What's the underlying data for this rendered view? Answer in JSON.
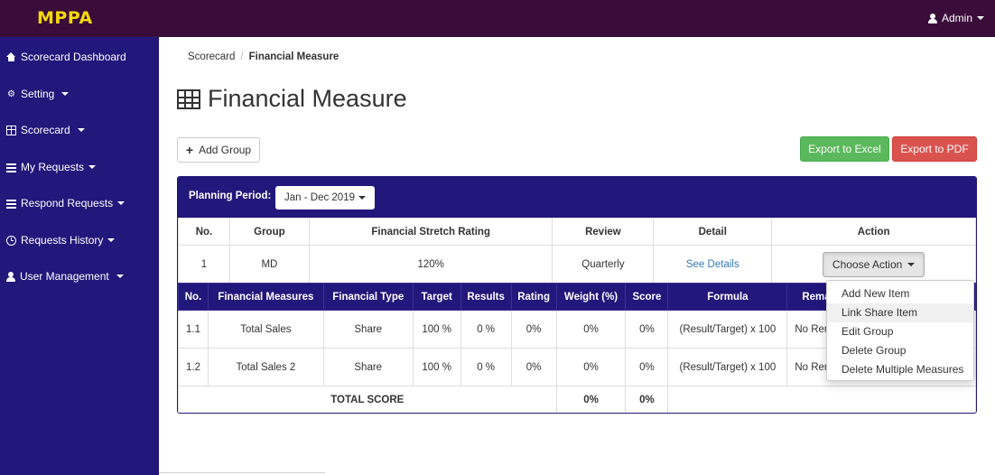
{
  "app": {
    "brand": "MPPA",
    "user": "Admin"
  },
  "sidebar": {
    "items": [
      {
        "label": "Scorecard Dashboard",
        "icon": "home-icon"
      },
      {
        "label": "Setting",
        "icon": "gear-icon"
      },
      {
        "label": "Scorecard",
        "icon": "grid-icon"
      },
      {
        "label": "My Requests",
        "icon": "list-icon"
      },
      {
        "label": "Respond Requests",
        "icon": "list-icon"
      },
      {
        "label": "Requests History",
        "icon": "clock-icon"
      },
      {
        "label": "User Management",
        "icon": "user-icon"
      }
    ]
  },
  "breadcrumb": {
    "parent": "Scorecard",
    "current": "Financial Measure"
  },
  "page": {
    "title": "Financial Measure"
  },
  "toolbar": {
    "add_group": "Add Group",
    "export_excel": "Export to Excel",
    "export_pdf": "Export to PDF"
  },
  "planning": {
    "label": "Planning Period:",
    "value": "Jan - Dec 2019"
  },
  "group_table": {
    "headers": [
      "No.",
      "Group",
      "Financial Stretch Rating",
      "Review",
      "Detail",
      "Action"
    ],
    "row": {
      "no": "1",
      "group": "MD",
      "rating": "120%",
      "review": "Quarterly",
      "detail": "See Details",
      "action": "Choose Action"
    }
  },
  "measure_table": {
    "headers": [
      "No.",
      "Financial Measures",
      "Financial Type",
      "Target",
      "Results",
      "Rating",
      "Weight (%)",
      "Score",
      "Formula",
      "Rema"
    ],
    "rows": [
      {
        "no": "1.1",
        "measure": "Total Sales",
        "type": "Share",
        "target": "100 %",
        "results": "0 %",
        "rating": "0%",
        "weight": "0%",
        "score": "0%",
        "formula": "(Result/Target) x 100",
        "remarks": "No Rem"
      },
      {
        "no": "1.2",
        "measure": "Total Sales 2",
        "type": "Share",
        "target": "100 %",
        "results": "0 %",
        "rating": "0%",
        "weight": "0%",
        "score": "0%",
        "formula": "(Result/Target) x 100",
        "remarks": "No Rem"
      }
    ],
    "total": {
      "label": "TOTAL SCORE",
      "weight": "0%",
      "score": "0%"
    }
  },
  "action_menu": {
    "items": [
      "Add New Item",
      "Link Share Item",
      "Edit Group",
      "Delete Group",
      "Delete Multiple Measures"
    ]
  },
  "colors": {
    "topbar": "#3a0c3a",
    "brand": "#f5d90a",
    "sidebar": "#22177a",
    "success": "#5cb85c",
    "danger": "#d9534f",
    "link": "#337ab7"
  }
}
